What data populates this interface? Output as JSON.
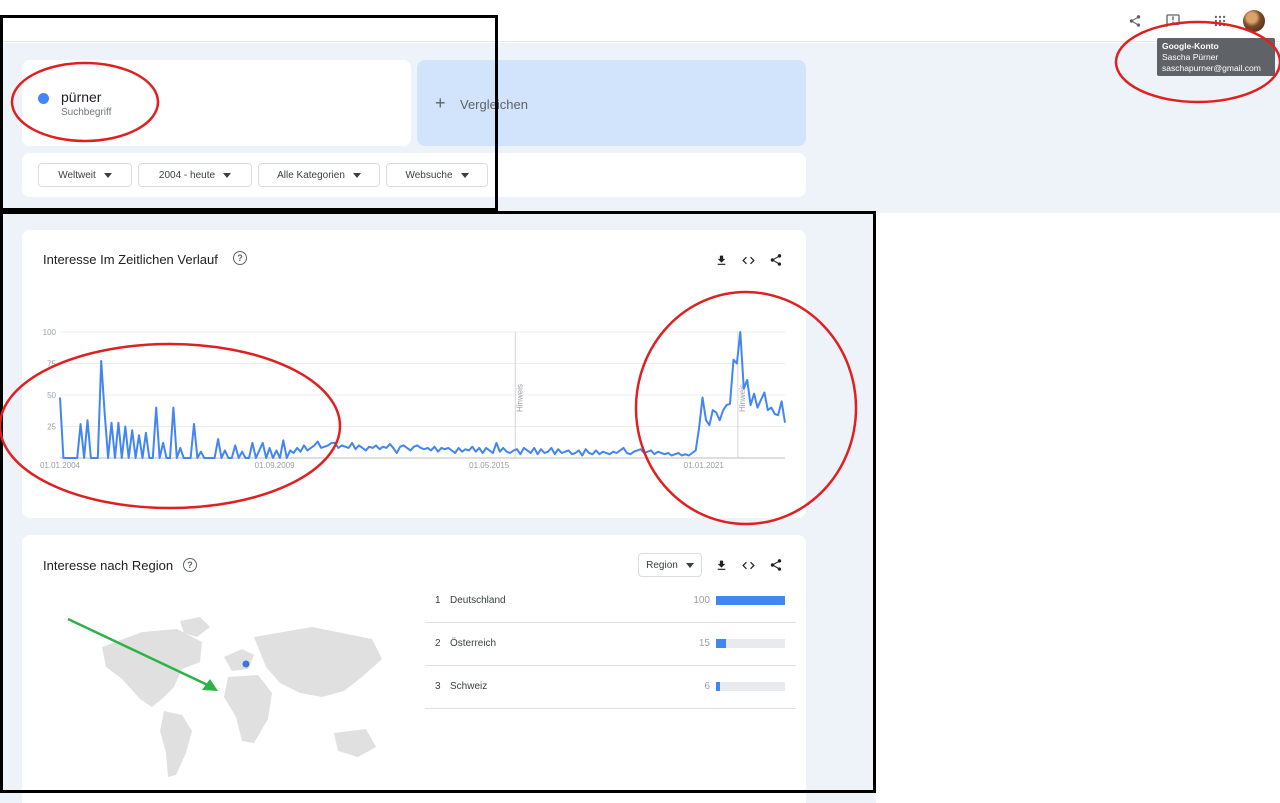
{
  "topbar": {
    "tooltip": {
      "title": "Google-Konto",
      "name": "Sascha Pürner",
      "email": "saschapurner@gmail.com"
    },
    "icons": [
      "share-icon",
      "feedback-icon",
      "apps-icon"
    ]
  },
  "search": {
    "term": "pürner",
    "term_type": "Suchbegriff",
    "term_color": "#4285f4",
    "compare_label": "Vergleichen"
  },
  "filters": [
    "Weltweit",
    "2004 - heute",
    "Alle Kategorien",
    "Websuche"
  ],
  "time_chart": {
    "title": "Interesse Im Zeitlichen Verlauf",
    "help": "?",
    "annotation_label": "Hinweis"
  },
  "region": {
    "title": "Interesse nach Region",
    "help": "?",
    "select_label": "Region",
    "rows": [
      {
        "rank": "1",
        "name": "Deutschland",
        "value": 100
      },
      {
        "rank": "2",
        "name": "Österreich",
        "value": 15
      },
      {
        "rank": "3",
        "name": "Schweiz",
        "value": 6
      }
    ]
  },
  "chart_data": {
    "type": "line",
    "series": [
      {
        "values": [
          48,
          0,
          0,
          0,
          0,
          0,
          27,
          0,
          30,
          0,
          0,
          0,
          77,
          35,
          0,
          28,
          0,
          28,
          0,
          25,
          0,
          22,
          0,
          18,
          0,
          20,
          0,
          0,
          40,
          0,
          12,
          0,
          0,
          40,
          0,
          8,
          0,
          0,
          0,
          27,
          0,
          5,
          0,
          0,
          0,
          0,
          15,
          0,
          6,
          0,
          0,
          10,
          0,
          5,
          0,
          0,
          12,
          0,
          6,
          12,
          0,
          8,
          0,
          6,
          0,
          14,
          0,
          6,
          4,
          8,
          5,
          10,
          6,
          8,
          10,
          13,
          8,
          9,
          10,
          12,
          12,
          8,
          10,
          9,
          8,
          12,
          7,
          10,
          8,
          6,
          9,
          8,
          10,
          7,
          9,
          8,
          11,
          8,
          4,
          9,
          10,
          8,
          6,
          9,
          10,
          8,
          7,
          8,
          6,
          9,
          5,
          8,
          7,
          8,
          6,
          4,
          8,
          5,
          7,
          6,
          9,
          5,
          8,
          4,
          8,
          6,
          4,
          12,
          5,
          8,
          5,
          4,
          6,
          7,
          3,
          8,
          6,
          4,
          8,
          3,
          7,
          4,
          5,
          8,
          3,
          7,
          4,
          5,
          6,
          3,
          4,
          6,
          2,
          7,
          4,
          3,
          6,
          3,
          5,
          4,
          3,
          5,
          4,
          6,
          8,
          4,
          3,
          5,
          6,
          7,
          4,
          5,
          6,
          3,
          5,
          4,
          3,
          4,
          2,
          3,
          4,
          2,
          3,
          2,
          4,
          6,
          24,
          48,
          30,
          26,
          38,
          36,
          30,
          38,
          42,
          43,
          78,
          75,
          100,
          55,
          62,
          42,
          51,
          40,
          46,
          52,
          38,
          40,
          35,
          34,
          45,
          28
        ],
        "color": "#4285f4"
      }
    ],
    "x_tick_labels": [
      "01.01.2004",
      "01.09.2009",
      "01.05.2015",
      "01.01.2021"
    ],
    "x_tick_positions": [
      0,
      0.296,
      0.592,
      0.888
    ],
    "annotation_positions": [
      0.628,
      0.935
    ],
    "ylim": [
      0,
      100
    ],
    "y_ticks": [
      25,
      50,
      75,
      100
    ]
  }
}
